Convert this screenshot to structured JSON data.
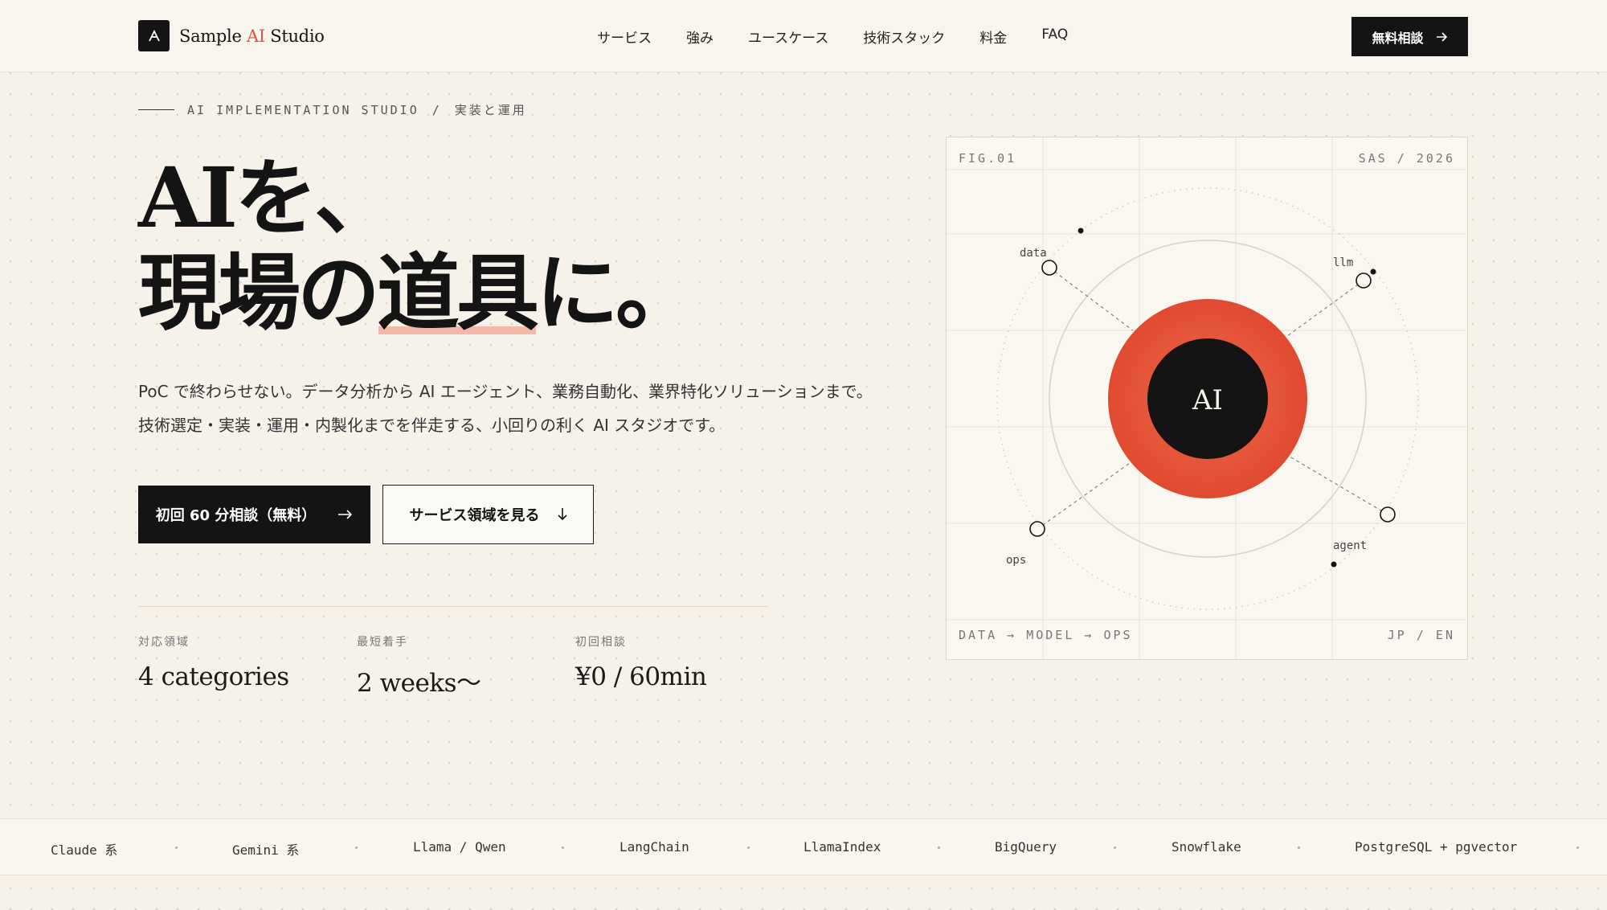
{
  "header": {
    "logo_prefix": "Sample ",
    "logo_accent": "AI",
    "logo_suffix": " Studio",
    "nav": [
      "サービス",
      "強み",
      "ユースケース",
      "技術スタック",
      "料金",
      "FAQ"
    ],
    "cta_label": "無料相談",
    "cta_icon": "arrow-right-icon"
  },
  "hero": {
    "eyebrow_en": "AI IMPLEMENTATION STUDIO",
    "eyebrow_sep": "/",
    "eyebrow_ja": "実装と運用",
    "headline_line1": "AIを、",
    "headline_line2_a": "現場の",
    "headline_line2_b": "道具",
    "headline_line2_c": "に。",
    "desc_line1": "PoC で終わらせない。データ分析から AI エージェント、業務自動化、業界特化ソリューションまで。",
    "desc_line2": "技術選定・実装・運用・内製化までを伴走する、小回りの利く AI スタジオです。",
    "primary_button": "初回 60 分相談（無料）",
    "primary_icon": "arrow-right-icon",
    "secondary_button": "サービス領域を見る",
    "secondary_icon": "arrow-down-icon"
  },
  "stats": [
    {
      "label": "対応領域",
      "value": "4 categories"
    },
    {
      "label": "最短着手",
      "value": "2 weeks〜"
    },
    {
      "label": "初回相談",
      "value": "¥0 / 60min"
    }
  ],
  "figure": {
    "top_left": "FIG.01",
    "top_right": "SAS / 2026",
    "bottom_left": "DATA → MODEL → OPS",
    "bottom_right": "JP / EN",
    "center_label": "AI",
    "nodes": [
      "data",
      "llm",
      "ops",
      "agent"
    ],
    "colors": {
      "accent": "#e2513a",
      "ink": "#141414"
    }
  },
  "ticker": [
    "Claude 系",
    "Gemini 系",
    "Llama / Qwen",
    "LangChain",
    "LlamaIndex",
    "BigQuery",
    "Snowflake",
    "PostgreSQL + pgvector"
  ]
}
